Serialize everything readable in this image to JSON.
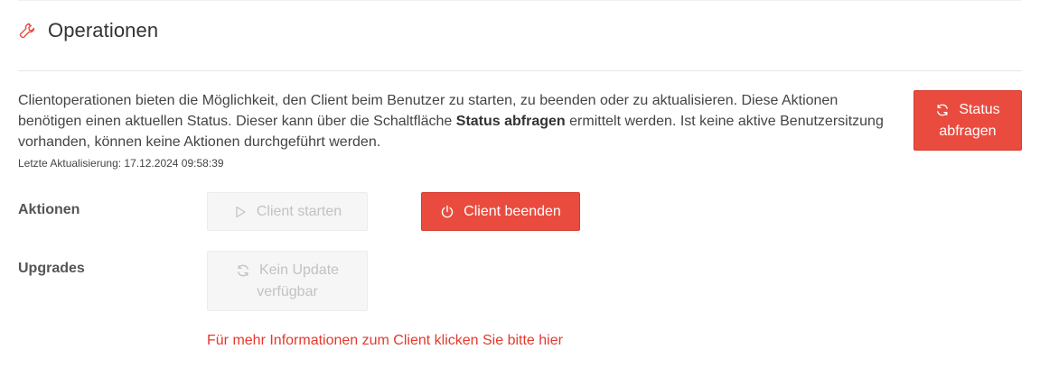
{
  "header": {
    "icon": "wrench-icon",
    "title": "Operationen"
  },
  "description": {
    "part1": "Clientoperationen bieten die Möglichkeit, den Client beim Benutzer zu starten, zu beenden oder zu aktualisieren. Diese Aktionen benötigen einen aktuellen Status. Dieser kann über die Schaltfläche ",
    "bold": "Status abfragen",
    "part2": " ermittelt werden. Ist keine aktive Benutzersitzung vorhanden, können keine Aktionen durchgeführt werden."
  },
  "last_updated": "Letzte Aktualisierung: 17.12.2024 09:58:39",
  "status_button": {
    "line1": "Status",
    "line2": "abfragen",
    "icon": "refresh-icon"
  },
  "actions": {
    "label": "Aktionen",
    "start_label": "Client starten",
    "start_icon": "play-icon",
    "stop_label": "Client beenden",
    "stop_icon": "power-icon"
  },
  "upgrades": {
    "label": "Upgrades",
    "line1": "Kein Update",
    "line2": "verfügbar",
    "icon": "refresh-icon"
  },
  "info_link": "Für mehr Informationen zum Client klicken Sie bitte hier",
  "colors": {
    "accent": "#e94c3f",
    "disabled_text": "#c2c2c2",
    "link": "#e23a2d"
  }
}
